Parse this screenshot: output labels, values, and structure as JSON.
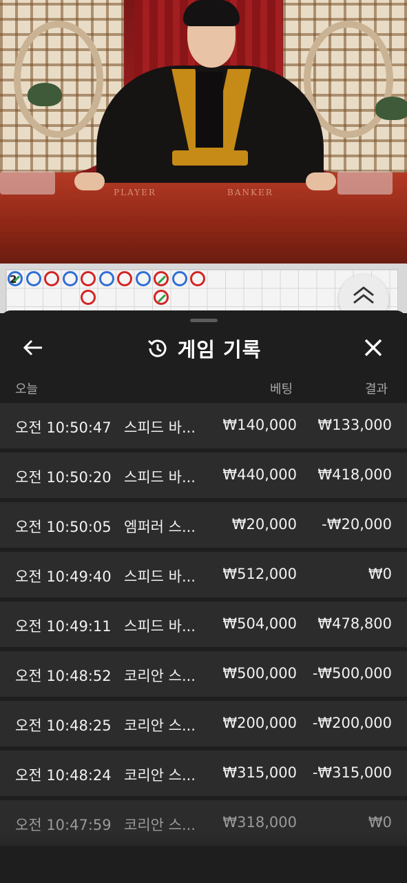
{
  "video": {
    "table_label_player": "PLAYER",
    "table_label_banker": "BANKER"
  },
  "roadmap": {
    "shoe_number": "2",
    "beads": [
      "player-tie",
      "player",
      "banker",
      "player",
      "banker",
      "player",
      "banker",
      "player",
      "banker-tie",
      "player",
      "banker"
    ],
    "second_row": [
      "banker",
      "banker-tie"
    ],
    "scroll_icon": "double-chevron-up-icon"
  },
  "sheet": {
    "title": "게임 기록",
    "title_icon": "history-icon",
    "back_icon": "arrow-left-icon",
    "close_icon": "close-icon",
    "columns": {
      "date": "오늘",
      "bet": "베팅",
      "result": "결과"
    },
    "rows": [
      {
        "time": "오전 10:50:47",
        "game": "스피드 바...",
        "bet": "₩140,000",
        "result": "₩133,000"
      },
      {
        "time": "오전 10:50:20",
        "game": "스피드 바...",
        "bet": "₩440,000",
        "result": "₩418,000"
      },
      {
        "time": "오전 10:50:05",
        "game": "엠퍼러 스...",
        "bet": "₩20,000",
        "result": "-₩20,000"
      },
      {
        "time": "오전 10:49:40",
        "game": "스피드 바...",
        "bet": "₩512,000",
        "result": "₩0"
      },
      {
        "time": "오전 10:49:11",
        "game": "스피드 바...",
        "bet": "₩504,000",
        "result": "₩478,800"
      },
      {
        "time": "오전 10:48:52",
        "game": "코리안 스...",
        "bet": "₩500,000",
        "result": "-₩500,000"
      },
      {
        "time": "오전 10:48:25",
        "game": "코리안 스...",
        "bet": "₩200,000",
        "result": "-₩200,000"
      },
      {
        "time": "오전 10:48:24",
        "game": "코리안 스...",
        "bet": "₩315,000",
        "result": "-₩315,000"
      },
      {
        "time": "오전 10:47:59",
        "game": "코리안 스...",
        "bet": "₩318,000",
        "result": "₩0"
      }
    ]
  },
  "colors": {
    "sheet_bg": "#1e1e1e",
    "row_bg": "#2c2c2c",
    "player_blue": "#2f6fd6",
    "banker_red": "#d32424",
    "tie_green": "#2ca44a"
  }
}
